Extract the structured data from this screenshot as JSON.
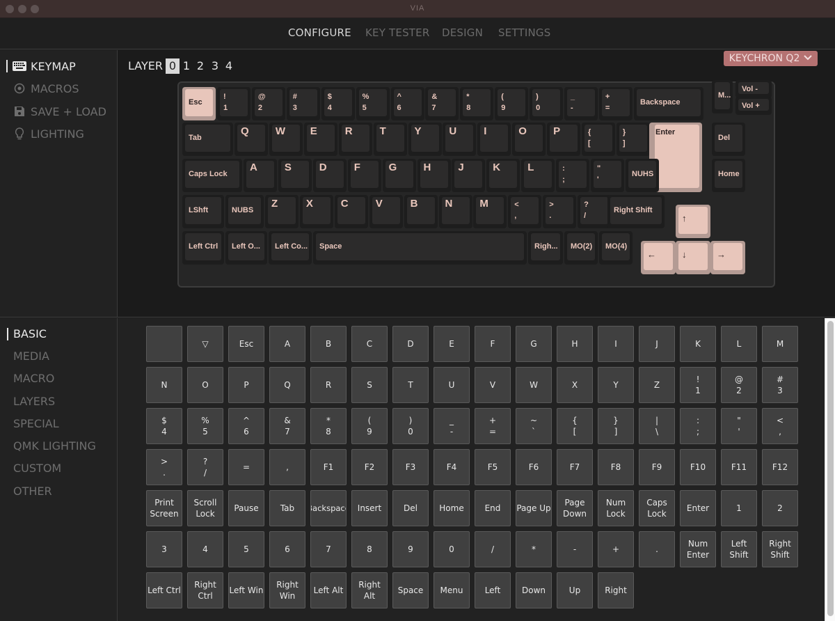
{
  "window": {
    "title": "VIA"
  },
  "nav": {
    "tabs": [
      {
        "label": "CONFIGURE",
        "active": true
      },
      {
        "label": "KEY TESTER",
        "active": false
      },
      {
        "label": "DESIGN",
        "active": false
      },
      {
        "label": "SETTINGS",
        "active": false
      }
    ]
  },
  "sidebar": {
    "items": [
      {
        "label": "KEYMAP",
        "icon": "keyboard-icon",
        "active": true
      },
      {
        "label": "MACROS",
        "icon": "circle-dot-icon",
        "active": false
      },
      {
        "label": "SAVE + LOAD",
        "icon": "floppy-disk-icon",
        "active": false
      },
      {
        "label": "LIGHTING",
        "icon": "lightbulb-icon",
        "active": false
      }
    ]
  },
  "layers": {
    "label": "LAYER",
    "options": [
      "0",
      "1",
      "2",
      "3",
      "4"
    ],
    "selected": "0"
  },
  "device": {
    "name": "KEYCHRON Q2",
    "chevron": "⌄"
  },
  "colors": {
    "accent": "#b57272",
    "keycap_accent": "#e8c6bb",
    "legend": "#eac7bc"
  },
  "keyboard": {
    "keys": [
      {
        "top": "Esc",
        "accent": true
      },
      {
        "top": "!",
        "bottom": "1"
      },
      {
        "top": "@",
        "bottom": "2"
      },
      {
        "top": "#",
        "bottom": "3"
      },
      {
        "top": "$",
        "bottom": "4"
      },
      {
        "top": "%",
        "bottom": "5"
      },
      {
        "top": "^",
        "bottom": "6"
      },
      {
        "top": "&",
        "bottom": "7"
      },
      {
        "top": "*",
        "bottom": "8"
      },
      {
        "top": "(",
        "bottom": "9"
      },
      {
        "top": ")",
        "bottom": "0"
      },
      {
        "top": "_",
        "bottom": "-"
      },
      {
        "top": "+",
        "bottom": "="
      },
      {
        "top": "Backspace"
      },
      {
        "top": "M..."
      },
      {
        "top": "Vol -"
      },
      {
        "top": "Vol +"
      },
      {
        "top": "Tab"
      },
      {
        "top": "Q"
      },
      {
        "top": "W"
      },
      {
        "top": "E"
      },
      {
        "top": "R"
      },
      {
        "top": "T"
      },
      {
        "top": "Y"
      },
      {
        "top": "U"
      },
      {
        "top": "I"
      },
      {
        "top": "O"
      },
      {
        "top": "P"
      },
      {
        "top": "{",
        "bottom": "["
      },
      {
        "top": "}",
        "bottom": "]"
      },
      {
        "top": "Enter",
        "accent": true
      },
      {
        "top": "Del"
      },
      {
        "top": "Caps Lock"
      },
      {
        "top": "A"
      },
      {
        "top": "S"
      },
      {
        "top": "D"
      },
      {
        "top": "F"
      },
      {
        "top": "G"
      },
      {
        "top": "H"
      },
      {
        "top": "J"
      },
      {
        "top": "K"
      },
      {
        "top": "L"
      },
      {
        "top": ":",
        "bottom": ";"
      },
      {
        "top": "\"",
        "bottom": "'"
      },
      {
        "top": "NUHS"
      },
      {
        "top": "Home"
      },
      {
        "top": "LShft"
      },
      {
        "top": "NUBS"
      },
      {
        "top": "Z"
      },
      {
        "top": "X"
      },
      {
        "top": "C"
      },
      {
        "top": "V"
      },
      {
        "top": "B"
      },
      {
        "top": "N"
      },
      {
        "top": "M"
      },
      {
        "top": "<",
        "bottom": ","
      },
      {
        "top": ">",
        "bottom": "."
      },
      {
        "top": "?",
        "bottom": "/"
      },
      {
        "top": "Right Shift"
      },
      {
        "top": "↑",
        "accent": true
      },
      {
        "top": "Left Ctrl"
      },
      {
        "top": "Left O..."
      },
      {
        "top": "Left Co..."
      },
      {
        "top": "Space"
      },
      {
        "top": "Righ..."
      },
      {
        "top": "MO(2)"
      },
      {
        "top": "MO(4)"
      },
      {
        "top": "←",
        "accent": true
      },
      {
        "top": "↓",
        "accent": true
      },
      {
        "top": "→",
        "accent": true
      }
    ]
  },
  "categories": {
    "items": [
      {
        "label": "BASIC",
        "active": true
      },
      {
        "label": "MEDIA",
        "active": false
      },
      {
        "label": "MACRO",
        "active": false
      },
      {
        "label": "LAYERS",
        "active": false
      },
      {
        "label": "SPECIAL",
        "active": false
      },
      {
        "label": "QMK LIGHTING",
        "active": false
      },
      {
        "label": "CUSTOM",
        "active": false
      },
      {
        "label": "OTHER",
        "active": false
      }
    ]
  },
  "keycodes": [
    "",
    "▽",
    "Esc",
    "A",
    "B",
    "C",
    "D",
    "E",
    "F",
    "G",
    "H",
    "I",
    "J",
    "K",
    "L",
    "M",
    "N",
    "O",
    "P",
    "Q",
    "R",
    "S",
    "T",
    "U",
    "V",
    "W",
    "X",
    "Y",
    "Z",
    "!\n1",
    "@\n2",
    "#\n3",
    "$\n4",
    "%\n5",
    "^\n6",
    "&\n7",
    "*\n8",
    "(\n9",
    ")\n0",
    "_\n-",
    "+\n=",
    "~\n`",
    "{\n[",
    "}\n]",
    "|\n\\",
    ":\n;",
    "\"\n'",
    "<\n,",
    ">\n.",
    "?\n/",
    "=",
    ",",
    "F1",
    "F2",
    "F3",
    "F4",
    "F5",
    "F6",
    "F7",
    "F8",
    "F9",
    "F10",
    "F11",
    "F12",
    "Print\nScreen",
    "Scroll\nLock",
    "Pause",
    "Tab",
    "Backspace",
    "Insert",
    "Del",
    "Home",
    "End",
    "Page Up",
    "Page\nDown",
    "Num\nLock",
    "Caps\nLock",
    "Enter",
    "1",
    "2",
    "3",
    "4",
    "5",
    "6",
    "7",
    "8",
    "9",
    "0",
    "/",
    "*",
    "-",
    "+",
    ".",
    "Num\nEnter",
    "Left\nShift",
    "Right\nShift",
    "Left Ctrl",
    "Right\nCtrl",
    "Left Win",
    "Right\nWin",
    "Left Alt",
    "Right Alt",
    "Space",
    "Menu",
    "Left",
    "Down",
    "Up",
    "Right"
  ]
}
